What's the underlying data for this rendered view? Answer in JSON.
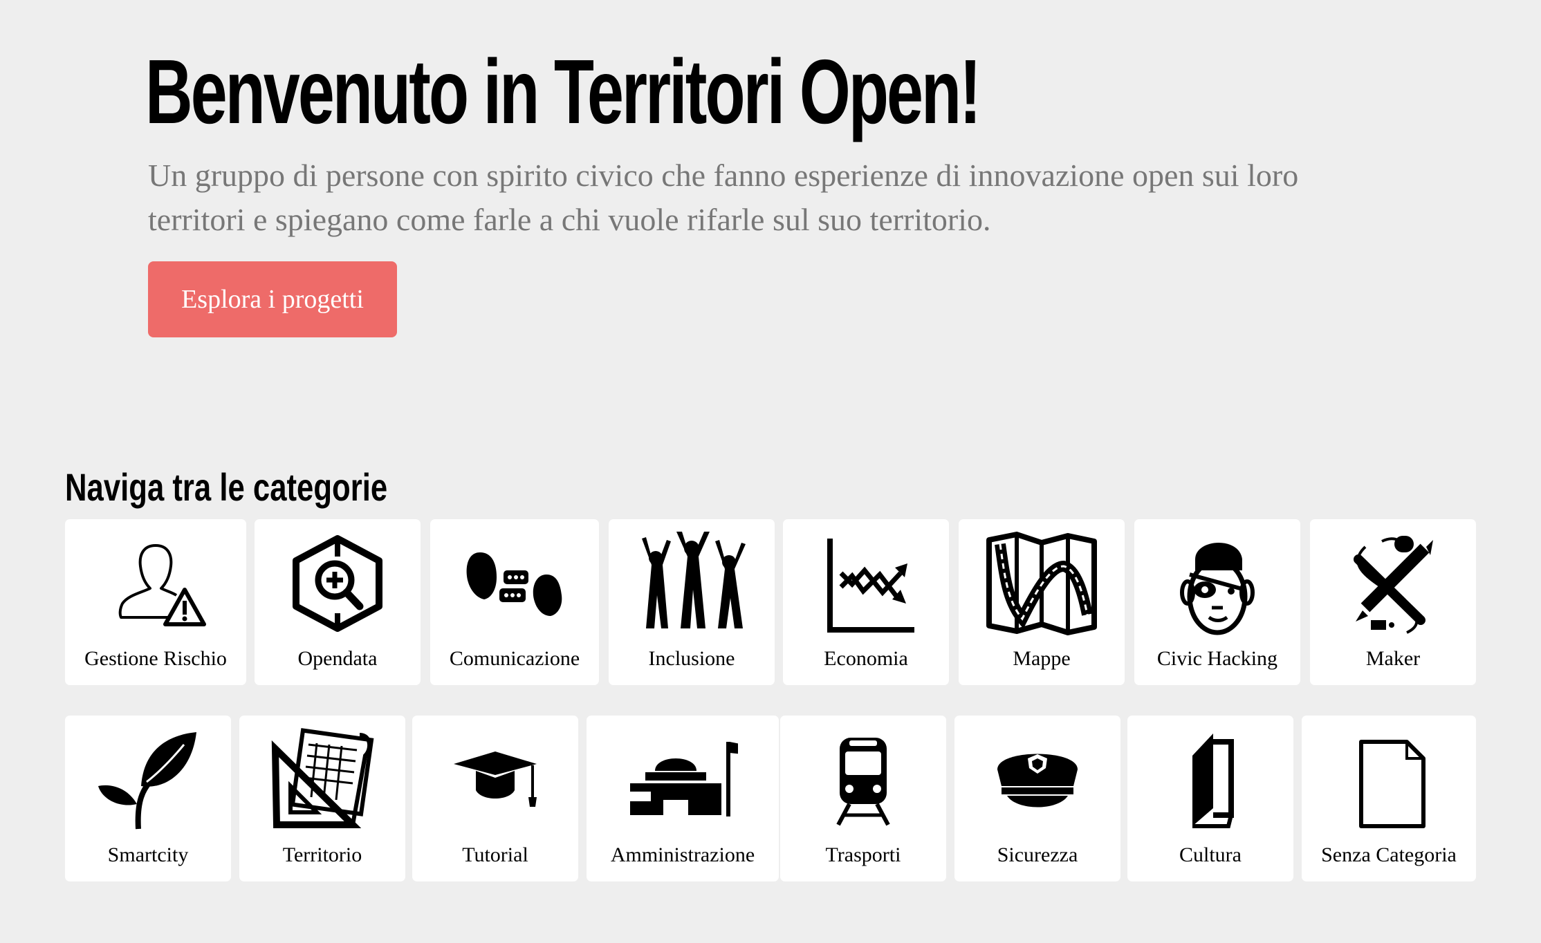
{
  "hero": {
    "title": "Benvenuto in Territori Open!",
    "subtitle": "Un gruppo di persone con spirito civico che fanno esperienze di innovazione open sui loro territori e spiegano come farle a chi vuole rifarle sul suo territorio.",
    "button_label": "Esplora i progetti"
  },
  "categories": {
    "heading": "Naviga tra le categorie",
    "items": [
      {
        "label": "Gestione Rischio",
        "icon": "person-warning-icon"
      },
      {
        "label": "Opendata",
        "icon": "hexagon-magnifier-icon"
      },
      {
        "label": "Comunicazione",
        "icon": "speech-bubbles-icon"
      },
      {
        "label": "Inclusione",
        "icon": "cheering-people-icon"
      },
      {
        "label": "Economia",
        "icon": "trend-chart-icon"
      },
      {
        "label": "Mappe",
        "icon": "folded-map-icon"
      },
      {
        "label": "Civic Hacking",
        "icon": "pirate-face-icon"
      },
      {
        "label": "Maker",
        "icon": "tools-pencil-icon"
      },
      {
        "label": "Smartcity",
        "icon": "leaf-sprout-icon"
      },
      {
        "label": "Territorio",
        "icon": "blueprint-ruler-icon"
      },
      {
        "label": "Tutorial",
        "icon": "graduation-cap-icon"
      },
      {
        "label": "Amministrazione",
        "icon": "government-building-icon"
      },
      {
        "label": "Trasporti",
        "icon": "train-icon"
      },
      {
        "label": "Sicurezza",
        "icon": "police-cap-icon"
      },
      {
        "label": "Cultura",
        "icon": "book-icon"
      },
      {
        "label": "Senza Categoria",
        "icon": "blank-document-icon"
      }
    ]
  },
  "colors": {
    "background": "#eeeeee",
    "button": "#ee6b69",
    "subtitle": "#777777",
    "card": "#ffffff"
  }
}
